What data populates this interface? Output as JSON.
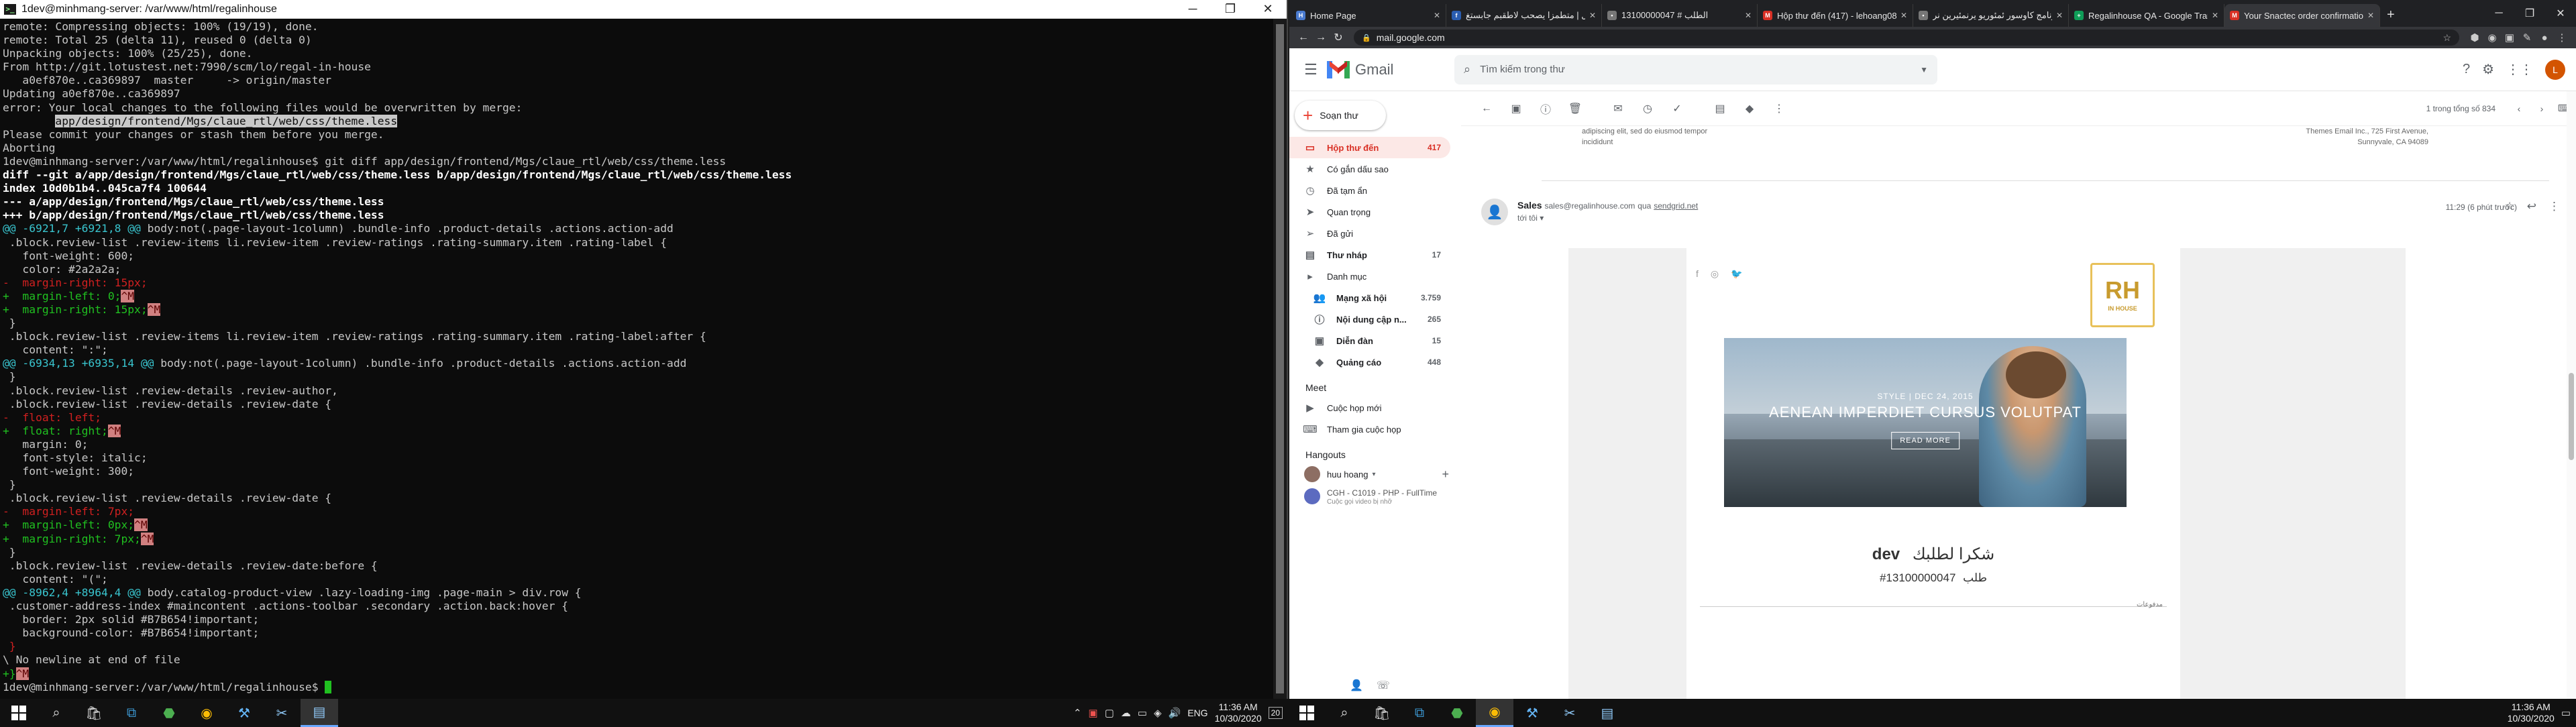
{
  "terminal": {
    "title": "1dev@minhmang-server: /var/www/html/regalinhouse",
    "lines": [
      [
        [
          "remote: Compressing objects: 100% (19/19), done.",
          ""
        ]
      ],
      [
        [
          "remote: Total 25 (delta 11), reused 0 (delta 0)",
          ""
        ]
      ],
      [
        [
          "Unpacking objects: 100% (25/25), done.",
          ""
        ]
      ],
      [
        [
          "From http://git.lotustest.net:7990/scm/lo/regal-in-house",
          ""
        ]
      ],
      [
        [
          "   a0ef870e..ca369897  master     -> origin/master",
          ""
        ]
      ],
      [
        [
          "Updating a0ef870e..ca369897",
          ""
        ]
      ],
      [
        [
          "error: Your local changes to the following files would be overwritten by merge:",
          ""
        ]
      ],
      [
        [
          "        ",
          ""
        ],
        [
          "app/design/frontend/Mgs/claue_rtl/web/css/theme.less",
          "hl"
        ]
      ],
      [
        [
          "Please commit your changes or stash them before you merge.",
          ""
        ]
      ],
      [
        [
          "Aborting",
          ""
        ]
      ],
      [
        [
          "1dev@minhmang-server:/var/www/html/regalinhouse$ git diff app/design/frontend/Mgs/claue_rtl/web/css/theme.less",
          ""
        ]
      ],
      [
        [
          "diff --git a/app/design/frontend/Mgs/claue_rtl/web/css/theme.less b/app/design/frontend/Mgs/claue_rtl/web/css/theme.less",
          "b"
        ]
      ],
      [
        [
          "index 10d0b1b4..045ca7f4 100644",
          "b"
        ]
      ],
      [
        [
          "--- a/app/design/frontend/Mgs/claue_rtl/web/css/theme.less",
          "b"
        ]
      ],
      [
        [
          "+++ b/app/design/frontend/Mgs/claue_rtl/web/css/theme.less",
          "b"
        ]
      ],
      [
        [
          "@@ -6921,7 +6921,8 @@",
          "c"
        ],
        [
          " body:not(.page-layout-1column) .bundle-info .product-details .actions.action-add",
          ""
        ]
      ],
      [
        [
          " .block.review-list .review-items li.review-item .review-ratings .rating-summary.item .rating-label {",
          ""
        ]
      ],
      [
        [
          "   font-weight: 600;",
          ""
        ]
      ],
      [
        [
          "   color: #2a2a2a;",
          ""
        ]
      ],
      [
        [
          "-  margin-right: 15px;",
          "r"
        ]
      ],
      [
        [
          "+  margin-left: 0;",
          "g"
        ],
        [
          "^M",
          "box"
        ]
      ],
      [
        [
          "+  margin-right: 15px;",
          "g"
        ],
        [
          "^M",
          "box"
        ]
      ],
      [
        [
          " }",
          ""
        ]
      ],
      [
        [
          " .block.review-list .review-items li.review-item .review-ratings .rating-summary.item .rating-label:after {",
          ""
        ]
      ],
      [
        [
          "   content: \":\";",
          ""
        ]
      ],
      [
        [
          "@@ -6934,13 +6935,14 @@",
          "c"
        ],
        [
          " body:not(.page-layout-1column) .bundle-info .product-details .actions.action-add",
          ""
        ]
      ],
      [
        [
          " }",
          ""
        ]
      ],
      [
        [
          " .block.review-list .review-details .review-author,",
          ""
        ]
      ],
      [
        [
          " .block.review-list .review-details .review-date {",
          ""
        ]
      ],
      [
        [
          "-  float: left;",
          "r"
        ]
      ],
      [
        [
          "+  float: right;",
          "g"
        ],
        [
          "^M",
          "box"
        ]
      ],
      [
        [
          "   margin: 0;",
          ""
        ]
      ],
      [
        [
          "   font-style: italic;",
          ""
        ]
      ],
      [
        [
          "   font-weight: 300;",
          ""
        ]
      ],
      [
        [
          " }",
          ""
        ]
      ],
      [
        [
          " .block.review-list .review-details .review-date {",
          ""
        ]
      ],
      [
        [
          "-  margin-left: 7px;",
          "r"
        ]
      ],
      [
        [
          "+  margin-left: 0px;",
          "g"
        ],
        [
          "^M",
          "box"
        ]
      ],
      [
        [
          "+  margin-right: 7px;",
          "g"
        ],
        [
          "^M",
          "box"
        ]
      ],
      [
        [
          " }",
          ""
        ]
      ],
      [
        [
          " .block.review-list .review-details .review-date:before {",
          ""
        ]
      ],
      [
        [
          "   content: \"(\";",
          ""
        ]
      ],
      [
        [
          "@@ -8962,4 +8964,4 @@",
          "c"
        ],
        [
          " body.catalog-product-view .lazy-loading-img .page-main > div.row {",
          ""
        ]
      ],
      [
        [
          " .customer-address-index #maincontent .actions-toolbar .secondary .action.back:hover {",
          ""
        ]
      ],
      [
        [
          "   border: 2px solid #B7B654!important;",
          ""
        ]
      ],
      [
        [
          "   background-color: #B7B654!important;",
          ""
        ]
      ],
      [
        [
          " }",
          "r"
        ]
      ],
      [
        [
          "\\ No newline at end of file",
          ""
        ]
      ],
      [
        [
          "+}",
          "g"
        ],
        [
          "^M",
          "box"
        ]
      ],
      [
        [
          "1dev@minhmang-server:/var/www/html/regalinhouse$ ",
          ""
        ],
        [
          " ",
          "cur"
        ]
      ]
    ]
  },
  "browser": {
    "tabs": [
      {
        "label": "Home Page",
        "color": "#4a7bd0",
        "glyph": "H"
      },
      {
        "label": "عليا إلتل | متطمزا يصحب لاطقبم جابستغ",
        "color": "#2a5db0",
        "glyph": "f"
      },
      {
        "label": "الطلب # 13100000047",
        "color": "#777",
        "glyph": "•"
      },
      {
        "label": "Hộp thư đến (417) - lehoang081",
        "color": "#d93025",
        "glyph": "M"
      },
      {
        "label": "برنامج كاوسور ئمئوريو يرنمئيرين نر",
        "color": "#777",
        "glyph": "•"
      },
      {
        "label": "Regalinhouse QA - Google Tran",
        "color": "#0f9d58",
        "glyph": "+"
      },
      {
        "label": "Your Snactec order confirmation",
        "color": "#d93025",
        "glyph": "M"
      }
    ],
    "active_tab": 6,
    "new_tab": "+",
    "url": "mail.google.com"
  },
  "gmail": {
    "title": "Gmail",
    "search_placeholder": "Tìm kiếm trong thư",
    "compose": "Soạn thư",
    "avatar_letter": "L",
    "nav": [
      {
        "label": "Hộp thư đến",
        "count": "417",
        "icon": "inbox-icon",
        "glyph": "▭",
        "active": true
      },
      {
        "label": "Có gắn dấu sao",
        "count": "",
        "icon": "star-icon",
        "glyph": "★"
      },
      {
        "label": "Đã tạm ẩn",
        "count": "",
        "icon": "clock-icon",
        "glyph": "◷"
      },
      {
        "label": "Quan trọng",
        "count": "",
        "icon": "important-icon",
        "glyph": "➤"
      },
      {
        "label": "Đã gửi",
        "count": "",
        "icon": "send-icon",
        "glyph": "➢"
      },
      {
        "label": "Thư nháp",
        "count": "17",
        "icon": "draft-icon",
        "glyph": "▤",
        "bold": true
      },
      {
        "label": "Danh mục",
        "count": "",
        "icon": "label-icon",
        "glyph": "▸"
      }
    ],
    "categories": [
      {
        "label": "Mạng xã hội",
        "count": "3.759",
        "icon": "social-icon",
        "glyph": "👥"
      },
      {
        "label": "Nội dung cập n...",
        "count": "265",
        "icon": "info-icon",
        "glyph": "ⓘ"
      },
      {
        "label": "Diễn đàn",
        "count": "15",
        "icon": "forum-icon",
        "glyph": "▣"
      },
      {
        "label": "Quảng cáo",
        "count": "448",
        "icon": "promo-icon",
        "glyph": "◆"
      }
    ],
    "meet_title": "Meet",
    "meet_items": [
      "Cuộc họp mới",
      "Tham gia cuộc họp"
    ],
    "hangouts_title": "Hangouts",
    "hangouts_user": "huu hoang",
    "hangouts_item": "CGH - C1019 - PHP - FullTime",
    "hangouts_sub": "Cuộc gọi video bị nhỡ",
    "pagination": "1 trong tổng số 834",
    "preview_left_1": "adipiscing elit, sed do eiusmod tempor",
    "preview_left_2": "incididunt",
    "preview_right_1": "Themes Email Inc., 725 First Avenue,",
    "preview_right_2": "Sunnyvale, CA 94089",
    "sender_name": "Sales",
    "sender_email": "sales@regalinhouse.com",
    "sender_via": "qua",
    "sender_domain": "sendgrid.net",
    "to_me": "tới tôi",
    "time": "11:29 (6 phút trước)",
    "email": {
      "brand_mark": "RH",
      "brand_name": "IN HOUSE",
      "hero_sub": "STYLE | DEC 24, 2015",
      "hero_title": "AENEAN IMPERDIET CURSUS VOLUTPAT",
      "hero_button": "READ MORE",
      "thanks_name": "dev",
      "thanks_text": "شكرا لطلبك",
      "order_label": "طلب",
      "order_number": "#13100000047",
      "small_text": "مدفوعات"
    }
  },
  "taskbar_left": {
    "time": "11:36 AM",
    "date": "10/30/2020",
    "lang": "ENG",
    "notif": "20"
  },
  "taskbar_right": {
    "time": "11:36 AM",
    "date": "10/30/2020"
  }
}
